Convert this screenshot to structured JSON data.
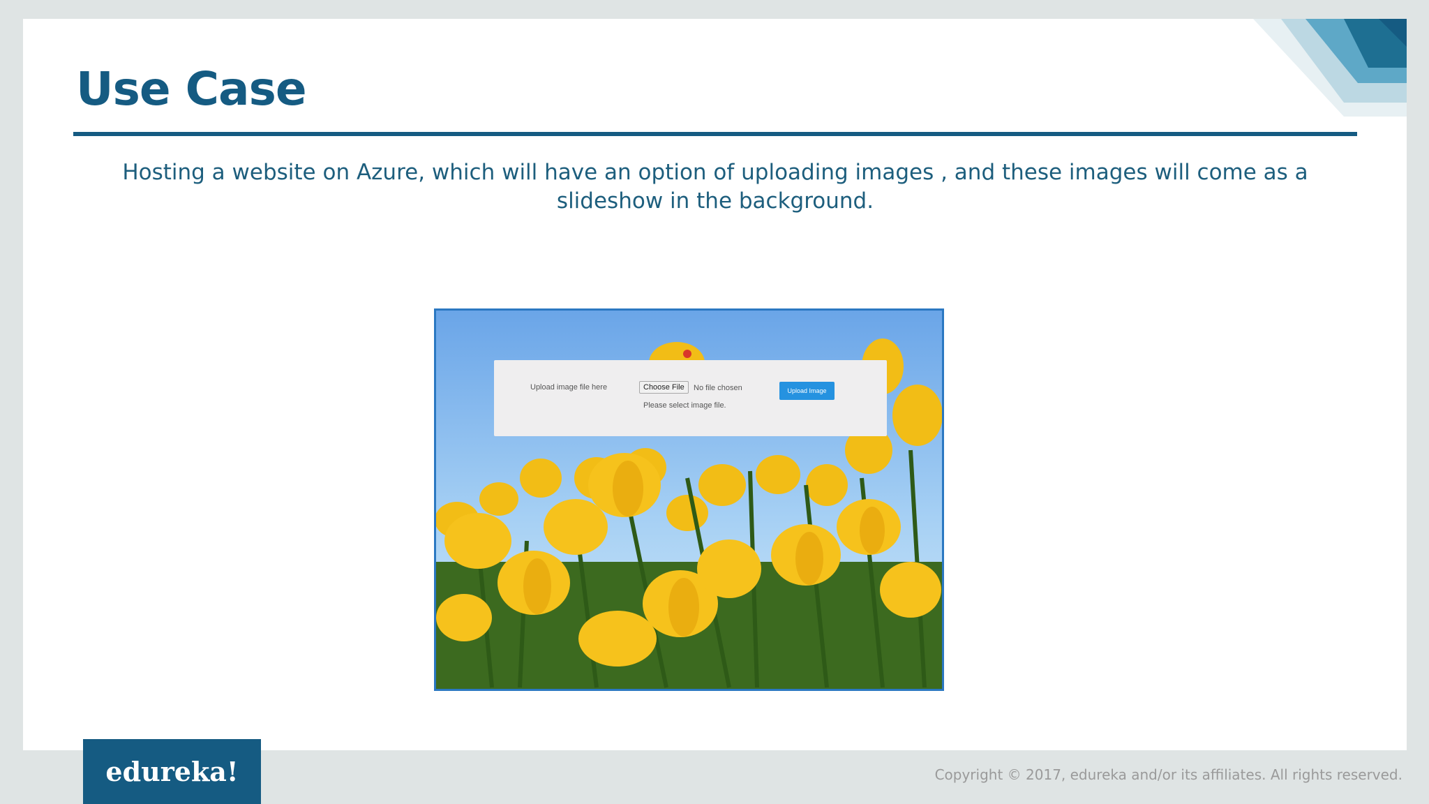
{
  "slide": {
    "title": "Use Case",
    "subtitle": "Hosting a website on Azure, which will have an option of uploading images , and these images will come as a slideshow in the background."
  },
  "screenshot": {
    "upload_label": "Upload image file here",
    "choose_file_label": "Choose File",
    "file_status": "No file chosen",
    "hint": "Please select image file.",
    "upload_button": "Upload Image"
  },
  "footer": {
    "logo_text": "edureka!",
    "copyright": "Copyright © 2017, edureka and/or its affiliates. All rights reserved."
  },
  "colors": {
    "brand": "#155b82",
    "upload_button": "#2592e0"
  }
}
